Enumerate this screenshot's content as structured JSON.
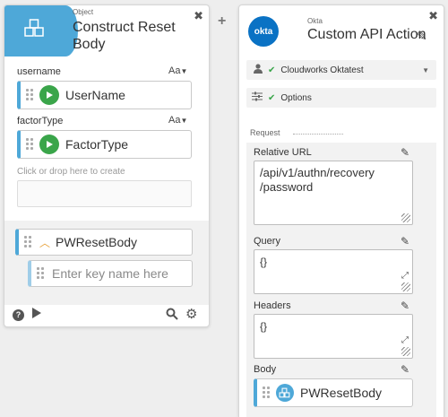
{
  "plus_sign": "+",
  "left_module": {
    "kicker": "Object",
    "title_line1": "Construct Reset",
    "title_line2": "Body",
    "close": "✖",
    "fields": [
      {
        "label": "username",
        "type": "Aa",
        "value": "UserName"
      },
      {
        "label": "factorType",
        "type": "Aa",
        "value": "FactorType"
      }
    ],
    "drop_hint": "Click or drop here to create",
    "nested": {
      "name": "PWResetBody",
      "key_placeholder": "Enter key name here"
    },
    "footer_icons": [
      "help-icon",
      "play-icon",
      "search-icon",
      "gear-icon"
    ]
  },
  "right_module": {
    "kicker": "Okta",
    "title": "Custom API Action",
    "close": "✖",
    "logo_text": "okta",
    "connection": "Cloudworks Oktatest",
    "options": "Options",
    "request_label": "Request",
    "relative_url": {
      "label": "Relative URL",
      "line1": "/api/v1/authn/recovery",
      "line2": "/password"
    },
    "query": {
      "label": "Query",
      "value": "{}"
    },
    "headers": {
      "label": "Headers",
      "value": "{}"
    },
    "body": {
      "label": "Body",
      "value": "PWResetBody"
    }
  },
  "colors": {
    "accent_blue": "#4ea8d8",
    "play_green": "#3aa54a",
    "okta_blue": "#0a72c4"
  }
}
